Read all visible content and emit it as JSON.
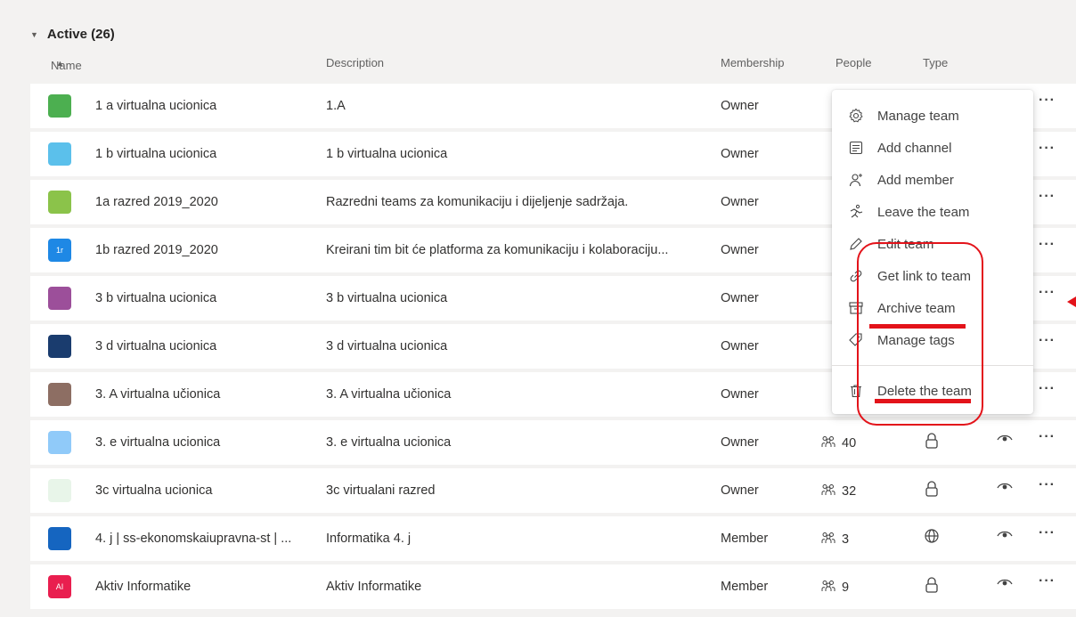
{
  "group": {
    "label": "Active (26)"
  },
  "columns": {
    "name": "Name",
    "description": "Description",
    "membership": "Membership",
    "people": "People",
    "type": "Type"
  },
  "teams": [
    {
      "name": "1 a virtualna ucionica",
      "description": "1.A",
      "membership": "Owner",
      "people": "",
      "type": "",
      "avatar_color": "#4caf50",
      "avatar_text": ""
    },
    {
      "name": "1 b virtualna ucionica",
      "description": "1 b virtualna ucionica",
      "membership": "Owner",
      "people": "",
      "type": "",
      "avatar_color": "#5bc0eb",
      "avatar_text": ""
    },
    {
      "name": "1a razred 2019_2020",
      "description": "Razredni teams za komunikaciju i dijeljenje sadržaja.",
      "membership": "Owner",
      "people": "",
      "type": "",
      "avatar_color": "#8bc34a",
      "avatar_text": ""
    },
    {
      "name": "1b razred 2019_2020",
      "description": "Kreirani tim bit će platforma za komunikaciju i kolaboraciju...",
      "membership": "Owner",
      "people": "",
      "type": "",
      "avatar_color": "#1e88e5",
      "avatar_text": "1r"
    },
    {
      "name": "3 b virtualna ucionica",
      "description": "3 b virtualna ucionica",
      "membership": "Owner",
      "people": "",
      "type": "",
      "avatar_color": "#9c4f9a",
      "avatar_text": ""
    },
    {
      "name": "3 d virtualna ucionica",
      "description": "3 d virtualna ucionica",
      "membership": "Owner",
      "people": "",
      "type": "",
      "avatar_color": "#1a3c6e",
      "avatar_text": ""
    },
    {
      "name": "3. A virtualna učionica",
      "description": "3. A virtualna učionica",
      "membership": "Owner",
      "people": "",
      "type": "",
      "avatar_color": "#8d6e63",
      "avatar_text": ""
    },
    {
      "name": "3. e virtualna ucionica",
      "description": "3. e virtualna ucionica",
      "membership": "Owner",
      "people": "40",
      "type": "private",
      "avatar_color": "#90caf9",
      "avatar_text": ""
    },
    {
      "name": "3c virtualna ucionica",
      "description": "3c virtualani razred",
      "membership": "Owner",
      "people": "32",
      "type": "private",
      "avatar_color": "#e8f5e9",
      "avatar_text": ""
    },
    {
      "name": "4. j | ss-ekonomskaiupravna-st | ...",
      "description": "Informatika 4. j",
      "membership": "Member",
      "people": "3",
      "type": "public",
      "avatar_color": "#1565c0",
      "avatar_text": ""
    },
    {
      "name": "Aktiv Informatike",
      "description": "Aktiv Informatike",
      "membership": "Member",
      "people": "9",
      "type": "private",
      "avatar_color": "#e91e4f",
      "avatar_text": "AI"
    }
  ],
  "menu": {
    "items": [
      {
        "label": "Manage team",
        "icon": "gear-icon"
      },
      {
        "label": "Add channel",
        "icon": "channel-icon"
      },
      {
        "label": "Add member",
        "icon": "add-member-icon"
      },
      {
        "label": "Leave the team",
        "icon": "leave-icon"
      },
      {
        "label": "Edit team",
        "icon": "pencil-icon"
      },
      {
        "label": "Get link to team",
        "icon": "link-icon"
      },
      {
        "label": "Archive team",
        "icon": "archive-icon"
      },
      {
        "label": "Manage tags",
        "icon": "tag-icon"
      },
      {
        "label": "Delete the team",
        "icon": "trash-icon"
      }
    ]
  },
  "colors": {
    "annotation": "#e3131a",
    "row_bg": "#ffffff",
    "page_bg": "#f3f2f1"
  }
}
